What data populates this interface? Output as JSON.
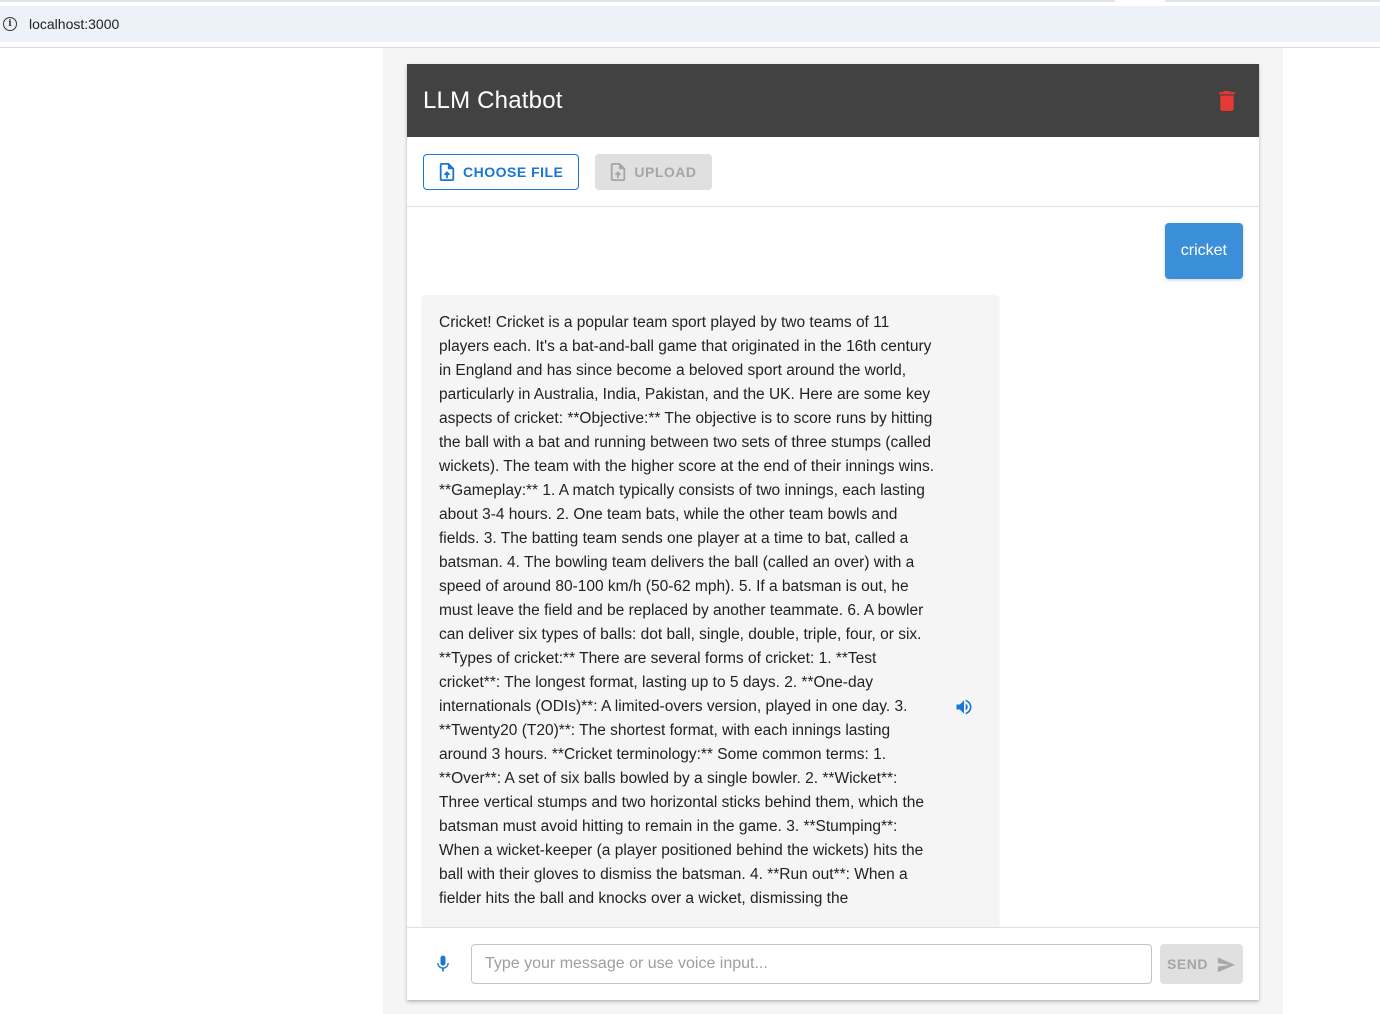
{
  "browser": {
    "url": "localhost:3000"
  },
  "app": {
    "title": "LLM Chatbot",
    "accent_color": "#1976d2",
    "header_color": "#424242",
    "delete_icon_color": "#e53935"
  },
  "upload": {
    "choose_file_label": "CHOOSE FILE",
    "upload_label": "UPLOAD"
  },
  "messages": {
    "user_message": "cricket",
    "bot_message": "Cricket! Cricket is a popular team sport played by two teams of 11 players each. It's a bat-and-ball game that originated in the 16th century in England and has since become a beloved sport around the world, particularly in Australia, India, Pakistan, and the UK. Here are some key aspects of cricket: **Objective:** The objective is to score runs by hitting the ball with a bat and running between two sets of three stumps (called wickets). The team with the higher score at the end of their innings wins. **Gameplay:** 1. A match typically consists of two innings, each lasting about 3-4 hours. 2. One team bats, while the other team bowls and fields. 3. The batting team sends one player at a time to bat, called a batsman. 4. The bowling team delivers the ball (called an over) with a speed of around 80-100 km/h (50-62 mph). 5. If a batsman is out, he must leave the field and be replaced by another teammate. 6. A bowler can deliver six types of balls: dot ball, single, double, triple, four, or six. **Types of cricket:** There are several forms of cricket: 1. **Test cricket**: The longest format, lasting up to 5 days. 2. **One-day internationals (ODIs)**: A limited-overs version, played in one day. 3. **Twenty20 (T20)**: The shortest format, with each innings lasting around 3 hours. **Cricket terminology:** Some common terms: 1. **Over**: A set of six balls bowled by a single bowler. 2. **Wicket**: Three vertical stumps and two horizontal sticks behind them, which the batsman must avoid hitting to remain in the game. 3. **Stumping**: When a wicket-keeper (a player positioned behind the wickets) hits the ball with their gloves to dismiss the batsman. 4. **Run out**: When a fielder hits the ball and knocks over a wicket, dismissing the"
  },
  "composer": {
    "placeholder": "Type your message or use voice input...",
    "value": "",
    "send_label": "SEND"
  },
  "icons": {
    "info": "info-icon",
    "delete": "trash-icon",
    "file_upload": "file-upload-icon",
    "speaker": "volume-up-icon",
    "mic": "mic-icon",
    "send": "send-icon"
  }
}
